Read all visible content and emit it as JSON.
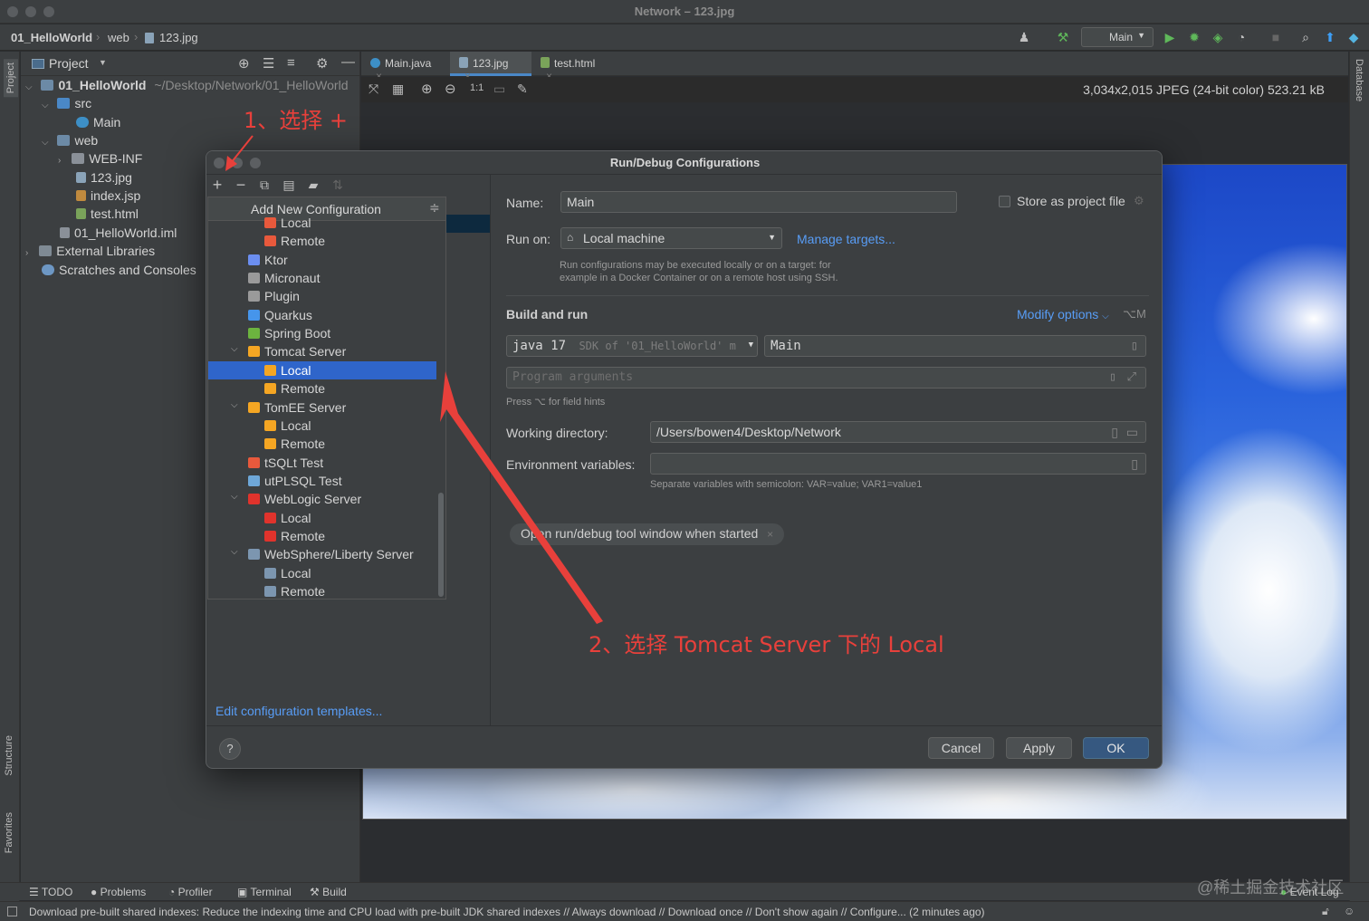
{
  "window": {
    "title": "Network – 123.jpg"
  },
  "navbar": {
    "breadcrumbs": [
      "01_HelloWorld",
      "web",
      "123.jpg"
    ],
    "run_config": "Main"
  },
  "stripes": {
    "project": "Project",
    "structure": "Structure",
    "favorites": "Favorites",
    "database": "Database"
  },
  "project_panel": {
    "title": "Project",
    "tree": [
      {
        "label": "01_HelloWorld",
        "path": "~/Desktop/Network/01_HelloWorld"
      },
      {
        "label": "src"
      },
      {
        "label": "Main"
      },
      {
        "label": "web"
      },
      {
        "label": "WEB-INF"
      },
      {
        "label": "123.jpg"
      },
      {
        "label": "index.jsp"
      },
      {
        "label": "test.html"
      },
      {
        "label": "01_HelloWorld.iml"
      },
      {
        "label": "External Libraries"
      },
      {
        "label": "Scratches and Consoles"
      }
    ]
  },
  "editor": {
    "tabs": [
      {
        "label": "Main.java"
      },
      {
        "label": "123.jpg"
      },
      {
        "label": "test.html"
      }
    ],
    "image_info": "3,034x2,015 JPEG (24-bit color) 523.21 kB",
    "zoom_label": "1:1"
  },
  "dialog": {
    "title": "Run/Debug Configurations",
    "popup": {
      "header": "Add New Configuration",
      "items": [
        {
          "label": "Local",
          "indent": 2,
          "icon": "jetty-icon",
          "color": "#e8593c"
        },
        {
          "label": "Remote",
          "indent": 2,
          "icon": "jetty-icon",
          "color": "#e8593c"
        },
        {
          "label": "Ktor",
          "indent": 1,
          "icon": "ktor-icon",
          "color": "#6b8ef0"
        },
        {
          "label": "Micronaut",
          "indent": 1,
          "icon": "micronaut-icon",
          "color": "#9a9a9a"
        },
        {
          "label": "Plugin",
          "indent": 1,
          "icon": "plugin-icon",
          "color": "#9a9a9a"
        },
        {
          "label": "Quarkus",
          "indent": 1,
          "icon": "quarkus-icon",
          "color": "#4695eb"
        },
        {
          "label": "Spring Boot",
          "indent": 1,
          "icon": "spring-boot-icon",
          "color": "#6cb33f"
        },
        {
          "label": "Tomcat Server",
          "indent": 1,
          "icon": "tomcat-icon",
          "color": "#f5a623",
          "expanded": true
        },
        {
          "label": "Local",
          "indent": 2,
          "icon": "tomcat-icon",
          "color": "#f5a623",
          "selected": true
        },
        {
          "label": "Remote",
          "indent": 2,
          "icon": "tomcat-icon",
          "color": "#f5a623"
        },
        {
          "label": "TomEE Server",
          "indent": 1,
          "icon": "tomee-icon",
          "color": "#f5a623",
          "expanded": true
        },
        {
          "label": "Local",
          "indent": 2,
          "icon": "tomee-icon",
          "color": "#f5a623"
        },
        {
          "label": "Remote",
          "indent": 2,
          "icon": "tomee-icon",
          "color": "#f5a623"
        },
        {
          "label": "tSQLt Test",
          "indent": 1,
          "icon": "tsqlt-icon",
          "color": "#e8593c"
        },
        {
          "label": "utPLSQL Test",
          "indent": 1,
          "icon": "utplsql-icon",
          "color": "#6ea7d8"
        },
        {
          "label": "WebLogic Server",
          "indent": 1,
          "icon": "weblogic-icon",
          "color": "#e0332c",
          "expanded": true
        },
        {
          "label": "Local",
          "indent": 2,
          "icon": "weblogic-icon",
          "color": "#e0332c"
        },
        {
          "label": "Remote",
          "indent": 2,
          "icon": "weblogic-icon",
          "color": "#e0332c"
        },
        {
          "label": "WebSphere/Liberty Server",
          "indent": 1,
          "icon": "websphere-icon",
          "color": "#7c96b0",
          "expanded": true
        },
        {
          "label": "Local",
          "indent": 2,
          "icon": "websphere-icon",
          "color": "#7c96b0"
        },
        {
          "label": "Remote",
          "indent": 2,
          "icon": "websphere-icon",
          "color": "#7c96b0"
        }
      ]
    },
    "edit_templates": "Edit configuration templates...",
    "form": {
      "name_label": "Name:",
      "name_value": "Main",
      "store_label": "Store as project file",
      "run_on_label": "Run on:",
      "run_on_value": "Local machine",
      "manage_targets": "Manage targets...",
      "run_on_hint_1": "Run configurations may be executed locally or on a target: for",
      "run_on_hint_2": "example in a Docker Container or on a remote host using SSH.",
      "build_run_title": "Build and run",
      "modify_options": "Modify options",
      "modify_shortcut": "⌥M",
      "jdk_value": "java 17",
      "jdk_hint": "SDK of '01_HelloWorld' m",
      "main_class": "Main",
      "program_args_placeholder": "Program arguments",
      "field_hints": "Press ⌥ for field hints",
      "workdir_label": "Working directory:",
      "workdir_value": "/Users/bowen4/Desktop/Network",
      "env_label": "Environment variables:",
      "env_value": "",
      "env_hint": "Separate variables with semicolon: VAR=value; VAR1=value1",
      "open_tool_chip": "Open run/debug tool window when started"
    },
    "buttons": {
      "cancel": "Cancel",
      "apply": "Apply",
      "ok": "OK",
      "help": "?"
    }
  },
  "annotations": {
    "step1": "1、选择 +",
    "step2": "2、选择 Tomcat Server 下的 Local",
    "color": "#e8403b"
  },
  "bottom_tools": [
    "TODO",
    "Problems",
    "Profiler",
    "Terminal",
    "Build"
  ],
  "event_log": "Event Log",
  "status_message": "Download pre-built shared indexes: Reduce the indexing time and CPU load with pre-built JDK shared indexes // Always download // Download once // Don't show again // Configure... (2 minutes ago)",
  "watermark": "@稀土掘金技术社区"
}
